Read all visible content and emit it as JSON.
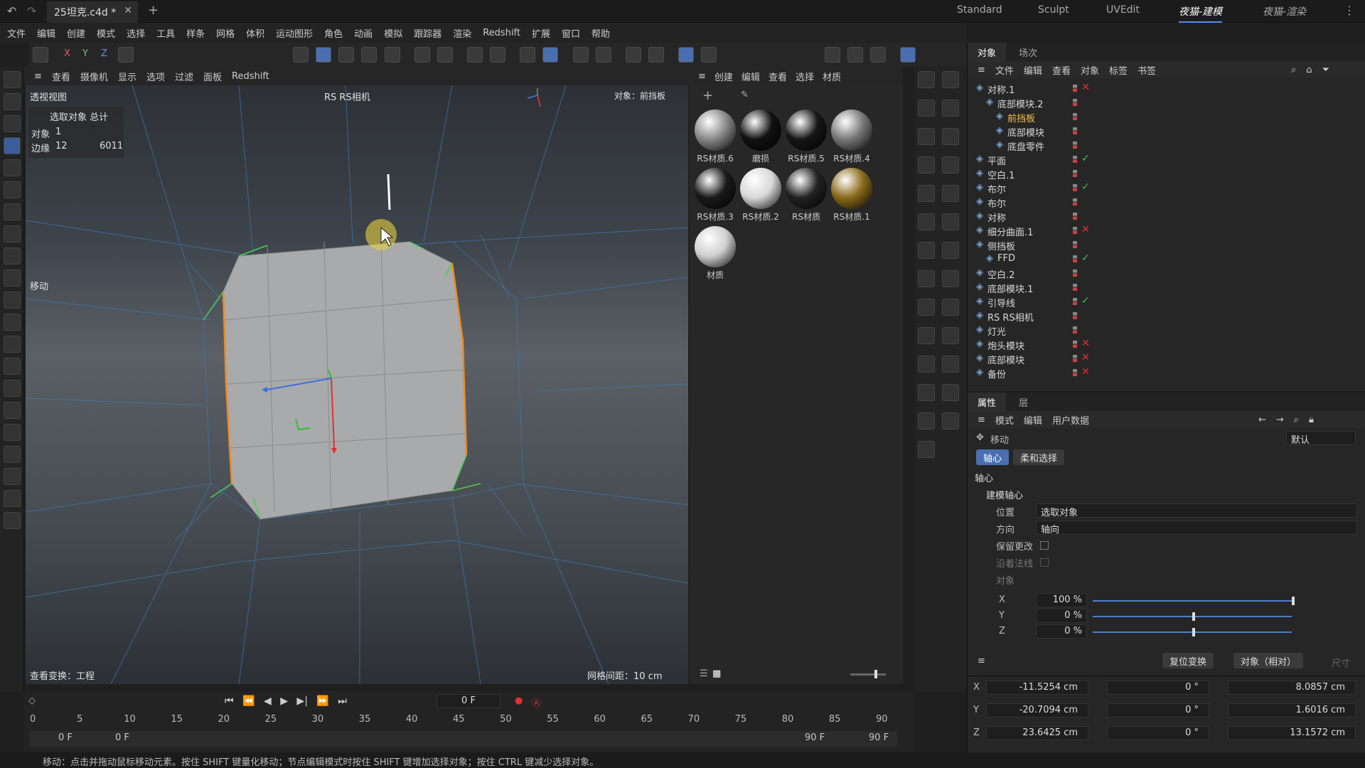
{
  "title_bar": {
    "doc_tab": "25坦克.c4d *",
    "layouts": [
      "Standard",
      "Sculpt",
      "UVEdit",
      "夜猫-建模",
      "夜猫-渲染"
    ],
    "active_layout": "夜猫-建模"
  },
  "menu": [
    "文件",
    "编辑",
    "创建",
    "模式",
    "选择",
    "工具",
    "样条",
    "网格",
    "体积",
    "运动图形",
    "角色",
    "动画",
    "模拟",
    "跟踪器",
    "渲染",
    "Redshift",
    "扩展",
    "窗口",
    "帮助"
  ],
  "toolbar": {
    "axes": [
      "X",
      "Y",
      "Z"
    ]
  },
  "viewport": {
    "menu": [
      "查看",
      "摄像机",
      "显示",
      "选项",
      "过滤",
      "面板",
      "Redshift"
    ],
    "name": "透视视图",
    "camera": "RS RS相机",
    "object_label": "对象：前挡板",
    "stats": {
      "header": "选取对象 总计",
      "objects_label": "对象",
      "objects": "1",
      "edges_label": "边缘",
      "edges_selected": "12",
      "edges_total": "6011"
    },
    "tool": "移动",
    "view_transform": "查看变换：工程",
    "grid_spacing": "网格间距：10 cm"
  },
  "materials": {
    "menu": [
      "创建",
      "编辑",
      "查看",
      "选择",
      "材质"
    ],
    "items": [
      {
        "name": "RS材质.6",
        "color": "#888"
      },
      {
        "name": "磨损",
        "color": "#111"
      },
      {
        "name": "RS材质.5",
        "color": "#161616"
      },
      {
        "name": "RS材质.4",
        "color": "#777"
      },
      {
        "name": "RS材质.3",
        "color": "#1a1a1a"
      },
      {
        "name": "RS材质.2",
        "color": "#d8d8d8"
      },
      {
        "name": "RS材质",
        "color": "#222"
      },
      {
        "name": "RS材质.1",
        "color": "#8a6a1a"
      },
      {
        "name": "材质",
        "color": "#cfcfcf"
      }
    ]
  },
  "object_manager": {
    "tabs": [
      "对象",
      "场次"
    ],
    "menu": [
      "文件",
      "编辑",
      "查看",
      "对象",
      "标签",
      "书签"
    ],
    "rows": [
      {
        "name": "对称.1",
        "indent": 0,
        "status": "x"
      },
      {
        "name": "底部模块.2",
        "indent": 1,
        "status": ""
      },
      {
        "name": "前挡板",
        "indent": 2,
        "status": "",
        "highlight": true
      },
      {
        "name": "底部模块",
        "indent": 2,
        "status": ""
      },
      {
        "name": "底盘零件",
        "indent": 2,
        "status": ""
      },
      {
        "name": "平面",
        "indent": 0,
        "status": "check"
      },
      {
        "name": "空白.1",
        "indent": 0,
        "status": ""
      },
      {
        "name": "布尔",
        "indent": 0,
        "status": "check"
      },
      {
        "name": "布尔",
        "indent": 0,
        "status": ""
      },
      {
        "name": "对称",
        "indent": 0,
        "status": ""
      },
      {
        "name": "细分曲面.1",
        "indent": 0,
        "status": "x"
      },
      {
        "name": "侧挡板",
        "indent": 0,
        "status": ""
      },
      {
        "name": "FFD",
        "indent": 1,
        "status": "check"
      },
      {
        "name": "空白.2",
        "indent": 0,
        "status": ""
      },
      {
        "name": "底部模块.1",
        "indent": 0,
        "status": ""
      },
      {
        "name": "引导线",
        "indent": 0,
        "status": "check"
      },
      {
        "name": "RS RS相机",
        "indent": 0,
        "status": ""
      },
      {
        "name": "灯光",
        "indent": 0,
        "status": ""
      },
      {
        "name": "炮头模块",
        "indent": 0,
        "status": "x"
      },
      {
        "name": "底部模块",
        "indent": 0,
        "status": "x"
      },
      {
        "name": "备份",
        "indent": 0,
        "status": "x"
      }
    ]
  },
  "attributes": {
    "tabs": [
      "属性",
      "层"
    ],
    "menu": [
      "模式",
      "编辑",
      "用户数据"
    ],
    "tool": "移动",
    "preset": "默认",
    "subtabs": [
      "轴心",
      "柔和选择"
    ],
    "section": "轴心",
    "group": "建模轴心",
    "position_label": "位置",
    "position_value": "选取对象",
    "direction_label": "方向",
    "direction_value": "轴向",
    "keep_changes": "保留更改",
    "along_normal": "沿着法线",
    "object_label": "对象",
    "x_label": "X",
    "x_value": "100 %",
    "x_fraction": 1.0,
    "y_label": "Y",
    "y_value": "0 %",
    "y_fraction": 0.5,
    "z_label": "Z",
    "z_value": "0 %",
    "z_fraction": 0.5
  },
  "coords": {
    "reset": "复位变换",
    "mode": "对象（相对）",
    "size_label": "尺寸",
    "rows": [
      {
        "axis": "X",
        "pos": "-11.5254 cm",
        "rot": "0 °",
        "size": "8.0857 cm"
      },
      {
        "axis": "Y",
        "pos": "-20.7094 cm",
        "rot": "0 °",
        "size": "1.6016 cm"
      },
      {
        "axis": "Z",
        "pos": "23.6425 cm",
        "rot": "0 °",
        "size": "13.1572 cm"
      }
    ]
  },
  "timeline": {
    "current_frame": "0 F",
    "ticks": [
      "0",
      "5",
      "10",
      "15",
      "20",
      "25",
      "30",
      "35",
      "40",
      "45",
      "50",
      "55",
      "60",
      "65",
      "70",
      "75",
      "80",
      "85",
      "90"
    ],
    "start": "0 F",
    "start2": "0 F",
    "end": "90 F",
    "end2": "90 F"
  },
  "status": "移动：点击并拖动鼠标移动元素。按住 SHIFT 键量化移动；节点编辑模式时按住 SHIFT 键增加选择对象；按住 CTRL 键减少选择对象。"
}
